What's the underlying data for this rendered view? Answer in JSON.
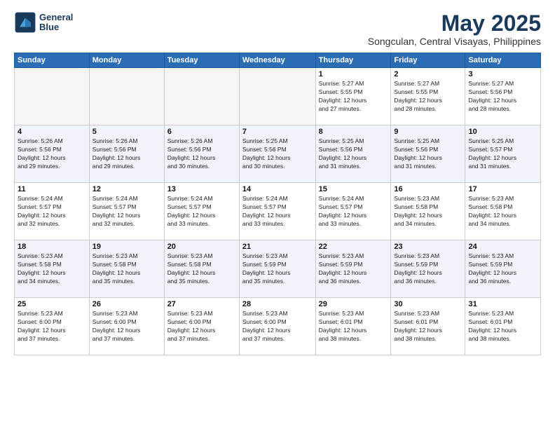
{
  "logo": {
    "line1": "General",
    "line2": "Blue"
  },
  "title": "May 2025",
  "subtitle": "Songculan, Central Visayas, Philippines",
  "weekdays": [
    "Sunday",
    "Monday",
    "Tuesday",
    "Wednesday",
    "Thursday",
    "Friday",
    "Saturday"
  ],
  "weeks": [
    [
      {
        "day": "",
        "info": ""
      },
      {
        "day": "",
        "info": ""
      },
      {
        "day": "",
        "info": ""
      },
      {
        "day": "",
        "info": ""
      },
      {
        "day": "1",
        "info": "Sunrise: 5:27 AM\nSunset: 5:55 PM\nDaylight: 12 hours\nand 27 minutes."
      },
      {
        "day": "2",
        "info": "Sunrise: 5:27 AM\nSunset: 5:55 PM\nDaylight: 12 hours\nand 28 minutes."
      },
      {
        "day": "3",
        "info": "Sunrise: 5:27 AM\nSunset: 5:56 PM\nDaylight: 12 hours\nand 28 minutes."
      }
    ],
    [
      {
        "day": "4",
        "info": "Sunrise: 5:26 AM\nSunset: 5:56 PM\nDaylight: 12 hours\nand 29 minutes."
      },
      {
        "day": "5",
        "info": "Sunrise: 5:26 AM\nSunset: 5:56 PM\nDaylight: 12 hours\nand 29 minutes."
      },
      {
        "day": "6",
        "info": "Sunrise: 5:26 AM\nSunset: 5:56 PM\nDaylight: 12 hours\nand 30 minutes."
      },
      {
        "day": "7",
        "info": "Sunrise: 5:25 AM\nSunset: 5:56 PM\nDaylight: 12 hours\nand 30 minutes."
      },
      {
        "day": "8",
        "info": "Sunrise: 5:25 AM\nSunset: 5:56 PM\nDaylight: 12 hours\nand 31 minutes."
      },
      {
        "day": "9",
        "info": "Sunrise: 5:25 AM\nSunset: 5:56 PM\nDaylight: 12 hours\nand 31 minutes."
      },
      {
        "day": "10",
        "info": "Sunrise: 5:25 AM\nSunset: 5:57 PM\nDaylight: 12 hours\nand 31 minutes."
      }
    ],
    [
      {
        "day": "11",
        "info": "Sunrise: 5:24 AM\nSunset: 5:57 PM\nDaylight: 12 hours\nand 32 minutes."
      },
      {
        "day": "12",
        "info": "Sunrise: 5:24 AM\nSunset: 5:57 PM\nDaylight: 12 hours\nand 32 minutes."
      },
      {
        "day": "13",
        "info": "Sunrise: 5:24 AM\nSunset: 5:57 PM\nDaylight: 12 hours\nand 33 minutes."
      },
      {
        "day": "14",
        "info": "Sunrise: 5:24 AM\nSunset: 5:57 PM\nDaylight: 12 hours\nand 33 minutes."
      },
      {
        "day": "15",
        "info": "Sunrise: 5:24 AM\nSunset: 5:57 PM\nDaylight: 12 hours\nand 33 minutes."
      },
      {
        "day": "16",
        "info": "Sunrise: 5:23 AM\nSunset: 5:58 PM\nDaylight: 12 hours\nand 34 minutes."
      },
      {
        "day": "17",
        "info": "Sunrise: 5:23 AM\nSunset: 5:58 PM\nDaylight: 12 hours\nand 34 minutes."
      }
    ],
    [
      {
        "day": "18",
        "info": "Sunrise: 5:23 AM\nSunset: 5:58 PM\nDaylight: 12 hours\nand 34 minutes."
      },
      {
        "day": "19",
        "info": "Sunrise: 5:23 AM\nSunset: 5:58 PM\nDaylight: 12 hours\nand 35 minutes."
      },
      {
        "day": "20",
        "info": "Sunrise: 5:23 AM\nSunset: 5:58 PM\nDaylight: 12 hours\nand 35 minutes."
      },
      {
        "day": "21",
        "info": "Sunrise: 5:23 AM\nSunset: 5:59 PM\nDaylight: 12 hours\nand 35 minutes."
      },
      {
        "day": "22",
        "info": "Sunrise: 5:23 AM\nSunset: 5:59 PM\nDaylight: 12 hours\nand 36 minutes."
      },
      {
        "day": "23",
        "info": "Sunrise: 5:23 AM\nSunset: 5:59 PM\nDaylight: 12 hours\nand 36 minutes."
      },
      {
        "day": "24",
        "info": "Sunrise: 5:23 AM\nSunset: 5:59 PM\nDaylight: 12 hours\nand 36 minutes."
      }
    ],
    [
      {
        "day": "25",
        "info": "Sunrise: 5:23 AM\nSunset: 6:00 PM\nDaylight: 12 hours\nand 37 minutes."
      },
      {
        "day": "26",
        "info": "Sunrise: 5:23 AM\nSunset: 6:00 PM\nDaylight: 12 hours\nand 37 minutes."
      },
      {
        "day": "27",
        "info": "Sunrise: 5:23 AM\nSunset: 6:00 PM\nDaylight: 12 hours\nand 37 minutes."
      },
      {
        "day": "28",
        "info": "Sunrise: 5:23 AM\nSunset: 6:00 PM\nDaylight: 12 hours\nand 37 minutes."
      },
      {
        "day": "29",
        "info": "Sunrise: 5:23 AM\nSunset: 6:01 PM\nDaylight: 12 hours\nand 38 minutes."
      },
      {
        "day": "30",
        "info": "Sunrise: 5:23 AM\nSunset: 6:01 PM\nDaylight: 12 hours\nand 38 minutes."
      },
      {
        "day": "31",
        "info": "Sunrise: 5:23 AM\nSunset: 6:01 PM\nDaylight: 12 hours\nand 38 minutes."
      }
    ]
  ]
}
